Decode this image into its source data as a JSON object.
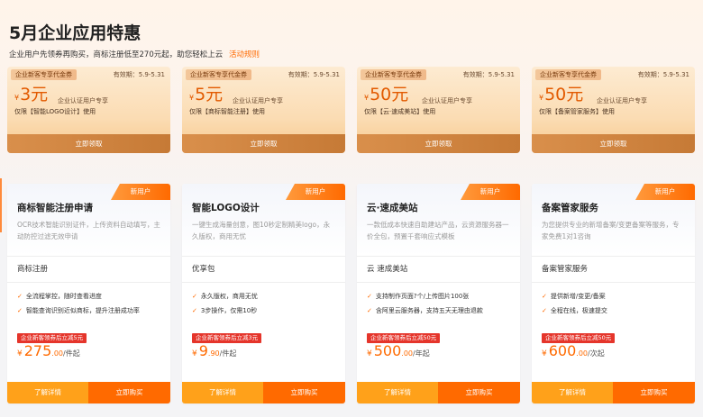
{
  "header": {
    "title": "5月企业应用特惠",
    "subtitle": "企业用户先领券再购买，商标注册低至270元起，助您轻松上云",
    "rules_link": "活动规则"
  },
  "coupons": [
    {
      "tag": "企业新客专享代金券",
      "validity": "有效期：5.9-5.31",
      "symbol": "¥",
      "amount": "3元",
      "condition": "企业认证用户专享",
      "limit": "仅限【智能LOGO设计】使用",
      "button": "立即领取"
    },
    {
      "tag": "企业新客专享代金券",
      "validity": "有效期：5.9-5.31",
      "symbol": "¥",
      "amount": "5元",
      "condition": "企业认证用户专享",
      "limit": "仅限【商标智能注册】使用",
      "button": "立即领取"
    },
    {
      "tag": "企业新客专享代金券",
      "validity": "有效期：5.9-5.31",
      "symbol": "¥",
      "amount": "50元",
      "condition": "企业认证用户专享",
      "limit": "仅限【云·速成美站】使用",
      "button": "立即领取"
    },
    {
      "tag": "企业新客专享代金券",
      "validity": "有效期：5.9-5.31",
      "symbol": "¥",
      "amount": "50元",
      "condition": "企业认证用户专享",
      "limit": "仅限【备案管家服务】使用",
      "button": "立即领取"
    }
  ],
  "products": [
    {
      "badge": "新用户",
      "title": "商标智能注册申请",
      "desc": "OCR技术智能识别证件，上传资料自动填写，主动防控过滤无效申请",
      "spec": "商标注册",
      "features": [
        "全流程掌控，随时查看进度",
        "智能查询识别近似商标，提升注册成功率"
      ],
      "promo": "企业新客领券后立减5元",
      "price_symbol": "¥",
      "price_int": "275",
      "price_dec": ".00",
      "price_unit": "/件起",
      "detail_btn": "了解详情",
      "buy_btn": "立即购买"
    },
    {
      "badge": "新用户",
      "title": "智能LOGO设计",
      "desc": "一键生成海量创意，图10秒定制精美logo，永久版权，商用无忧",
      "spec": "优享包",
      "features": [
        "永久版权，商用无忧",
        "3步操作，仅需10秒"
      ],
      "promo": "企业新客领券后立减3元",
      "price_symbol": "¥",
      "price_int": "9",
      "price_dec": ".90",
      "price_unit": "/件起",
      "detail_btn": "了解详情",
      "buy_btn": "立即购买"
    },
    {
      "badge": "新用户",
      "title": "云·速成美站",
      "desc": "一款低成本快速自助建站产品，云资源服务器一价全包，预置千套响应式模板",
      "spec": "云 速成美站",
      "features": [
        "支持制作页面?个/上传图片100张",
        "含阿里云服务器，支持五天无理由退款"
      ],
      "promo": "企业新客领券后立减50元",
      "price_symbol": "¥",
      "price_int": "500",
      "price_dec": ".00",
      "price_unit": "/年起",
      "detail_btn": "了解详情",
      "buy_btn": "立即购买"
    },
    {
      "badge": "新用户",
      "title": "备案管家服务",
      "desc": "为您提供专业的新增备案/变更备案等服务，专家免费1对1咨询",
      "spec": "备案管家服务",
      "features": [
        "提供新增/变更/备案",
        "全程在线，极速提交"
      ],
      "promo": "企业新客领券后立减50元",
      "price_symbol": "¥",
      "price_int": "600",
      "price_dec": ".00",
      "price_unit": "/次起",
      "detail_btn": "了解详情",
      "buy_btn": "立即购买"
    }
  ],
  "colors": {
    "accent": "#ff6a00",
    "accent_light": "#ffa11a",
    "promo_red": "#e5352b"
  }
}
